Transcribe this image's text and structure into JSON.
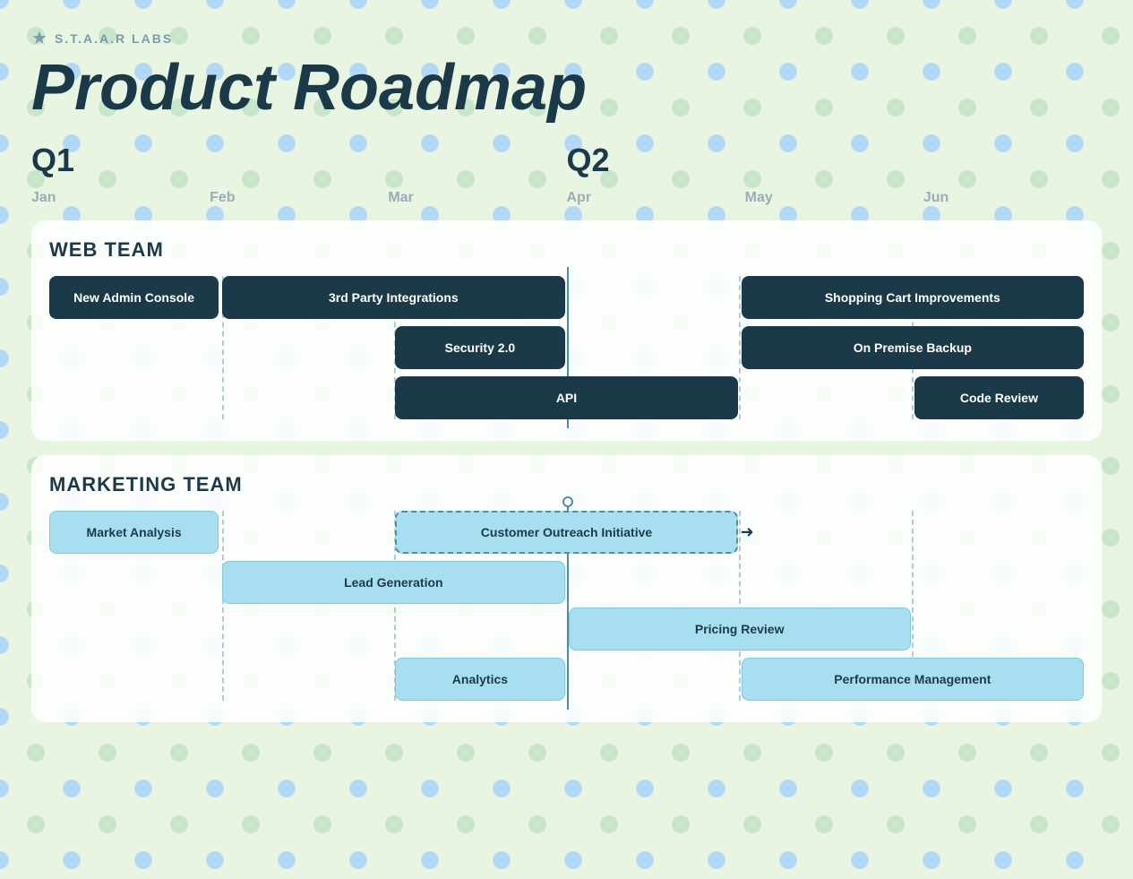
{
  "brand": {
    "name": "S.T.A.A.R LABS"
  },
  "title": "Product Roadmap",
  "quarters": [
    {
      "label": "Q1",
      "col": 1
    },
    {
      "label": "Q2",
      "col": 4
    }
  ],
  "months": [
    {
      "label": "Jan"
    },
    {
      "label": "Feb"
    },
    {
      "label": "Mar"
    },
    {
      "label": "Apr"
    },
    {
      "label": "May"
    },
    {
      "label": "Jun"
    }
  ],
  "web_team": {
    "title": "WEB TEAM",
    "rows": [
      {
        "items": [
          {
            "label": "New Admin Console",
            "colStart": 1,
            "colSpan": 1,
            "style": "dark"
          },
          {
            "label": "3rd Party Integrations",
            "colStart": 2,
            "colSpan": 2,
            "style": "dark"
          },
          {
            "label": "Shopping Cart Improvements",
            "colStart": 5,
            "colSpan": 2,
            "style": "dark"
          }
        ]
      },
      {
        "items": [
          {
            "label": "Security 2.0",
            "colStart": 3,
            "colSpan": 1,
            "style": "dark"
          },
          {
            "label": "On Premise Backup",
            "colStart": 5,
            "colSpan": 2,
            "style": "dark"
          }
        ]
      },
      {
        "items": [
          {
            "label": "API",
            "colStart": 3,
            "colSpan": 2,
            "style": "dark"
          },
          {
            "label": "Code Review",
            "colStart": 6,
            "colSpan": 1,
            "style": "dark"
          }
        ]
      }
    ]
  },
  "marketing_team": {
    "title": "MARKETING TEAM",
    "rows": [
      {
        "items": [
          {
            "label": "Market Analysis",
            "colStart": 1,
            "colSpan": 1,
            "style": "light"
          },
          {
            "label": "Customer Outreach Initiative",
            "colStart": 3,
            "colSpan": 2,
            "style": "selected"
          }
        ]
      },
      {
        "items": [
          {
            "label": "Lead Generation",
            "colStart": 2,
            "colSpan": 2,
            "style": "light"
          },
          {
            "label": "Pricing Review",
            "colStart": 4,
            "colSpan": 2,
            "style": "light"
          }
        ]
      },
      {
        "items": [
          {
            "label": "Analytics",
            "colStart": 3,
            "colSpan": 1,
            "style": "light"
          },
          {
            "label": "Performance Management",
            "colStart": 5,
            "colSpan": 2,
            "style": "light"
          }
        ]
      }
    ]
  }
}
